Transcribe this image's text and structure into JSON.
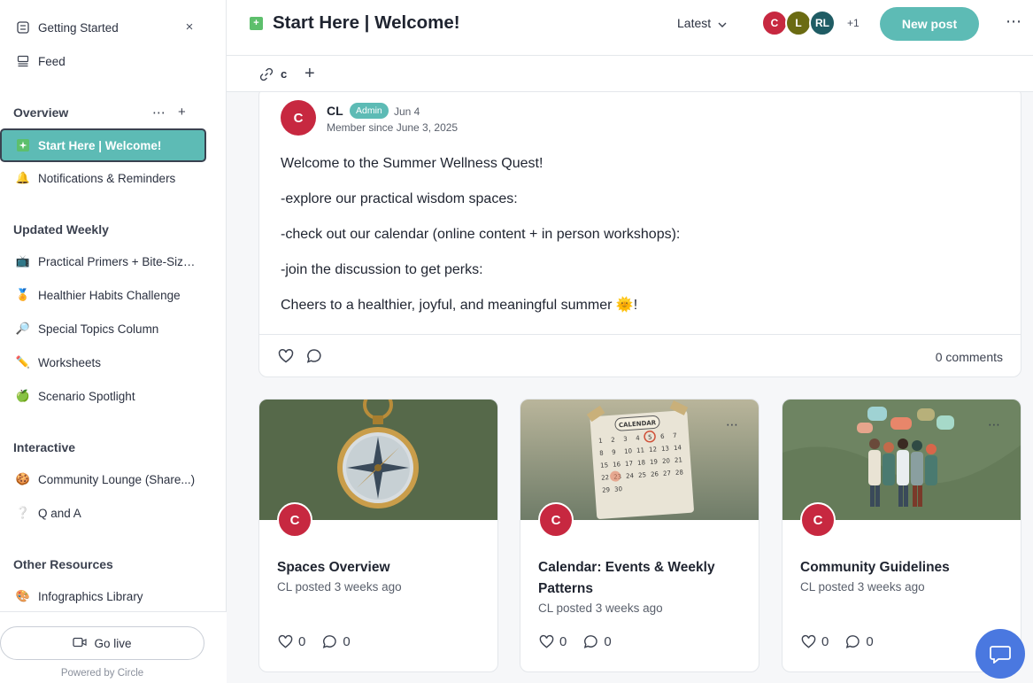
{
  "sidebar": {
    "top_items": [
      {
        "label": "Getting Started",
        "icon": "checklist-icon"
      },
      {
        "label": "Feed",
        "icon": "feed-icon"
      }
    ],
    "sections": [
      {
        "heading": "Overview",
        "items": [
          {
            "label": "Start Here | Welcome!",
            "icon": "sparkle-icon",
            "active": true
          },
          {
            "label": "Notifications & Reminders",
            "icon": "bell-icon"
          }
        ]
      },
      {
        "heading": "Updated Weekly",
        "items": [
          {
            "label": "Practical Primers + Bite-Sized Lessons",
            "icon": "tv-icon"
          },
          {
            "label": "Healthier Habits Challenge",
            "icon": "medal-icon"
          },
          {
            "label": "Special Topics Column",
            "icon": "magnifier-icon"
          },
          {
            "label": "Worksheets",
            "icon": "pencil-icon"
          },
          {
            "label": "Scenario Spotlight",
            "icon": "apple-icon"
          }
        ]
      },
      {
        "heading": "Interactive",
        "items": [
          {
            "label": "Community Lounge (Share...)",
            "icon": "cookie-icon"
          },
          {
            "label": "Q and A",
            "icon": "question-icon"
          }
        ]
      },
      {
        "heading": "Other Resources",
        "items": [
          {
            "label": "Infographics Library",
            "icon": "palette-icon"
          }
        ]
      }
    ],
    "go_live_label": "Go live",
    "powered_by": "Powered by Circle"
  },
  "header": {
    "title": "Start Here | Welcome!",
    "sort_label": "Latest",
    "avatars": [
      {
        "initials": "C",
        "color": "#c72840"
      },
      {
        "initials": "L",
        "color": "#6b6b12"
      },
      {
        "initials": "RL",
        "color": "#1f5c64"
      }
    ],
    "avatar_more": "+1",
    "new_post_label": "New post",
    "link_label": "c"
  },
  "post": {
    "avatar_initial": "C",
    "author": "CL",
    "badge": "Admin",
    "date": "Jun 4",
    "member_since": "Member since June 3, 2025",
    "paragraphs": [
      "Welcome to the Summer Wellness Quest!",
      "-explore our practical wisdom spaces:",
      "-check out our calendar (online content + in person workshops):",
      "-join the discussion to get perks:",
      "Cheers to a healthier, joyful, and meaningful summer 🌞!"
    ],
    "comments_label": "0 comments"
  },
  "cards": [
    {
      "title": "Spaces Overview",
      "meta": "CL posted 3 weeks ago",
      "likes": "0",
      "comments": "0",
      "avatar_initial": "C"
    },
    {
      "title": "Calendar: Events & Weekly Patterns",
      "meta": "CL posted 3 weeks ago",
      "likes": "0",
      "comments": "0",
      "avatar_initial": "C"
    },
    {
      "title": "Community Guidelines",
      "meta": "CL posted 3 weeks ago",
      "likes": "0",
      "comments": "0",
      "avatar_initial": "C"
    }
  ],
  "colors": {
    "accent": "#5dbbb5",
    "avatar_red": "#c72840",
    "chat_blue": "#4a78e0"
  }
}
